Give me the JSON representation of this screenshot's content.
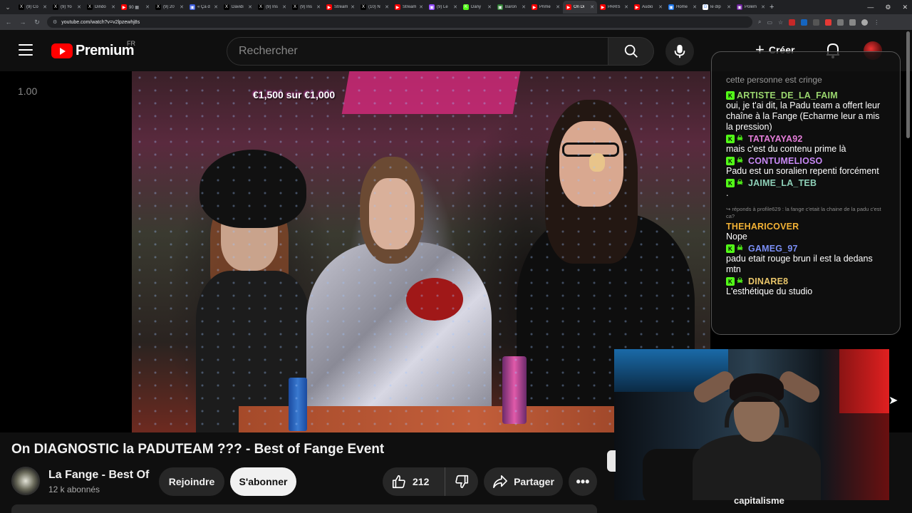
{
  "browser": {
    "tabs": [
      {
        "title": "(9) Co",
        "fav": "X",
        "color": "#000000"
      },
      {
        "title": "(9) Yo",
        "fav": "X",
        "color": "#000000"
      },
      {
        "title": "Dindo",
        "fav": "X",
        "color": "#000000"
      },
      {
        "title": "90 ▦",
        "fav": "▶",
        "color": "#ff0000"
      },
      {
        "title": "(9) 20",
        "fav": "X",
        "color": "#000000"
      },
      {
        "title": "« Ça d",
        "fav": "▣",
        "color": "#3b5bdb"
      },
      {
        "title": "Davidi",
        "fav": "X",
        "color": "#000000"
      },
      {
        "title": "(9) Ins",
        "fav": "X",
        "color": "#000000"
      },
      {
        "title": "(9) Ins",
        "fav": "X",
        "color": "#000000"
      },
      {
        "title": "Stream",
        "fav": "▶",
        "color": "#ff0000"
      },
      {
        "title": "(10) N",
        "fav": "X",
        "color": "#000000"
      },
      {
        "title": "Stream",
        "fav": "▶",
        "color": "#ff0000"
      },
      {
        "title": "(9) Le",
        "fav": "▣",
        "color": "#9146ff"
      },
      {
        "title": "Dany",
        "fav": "K",
        "color": "#53fc18"
      },
      {
        "title": "Baron",
        "fav": "▣",
        "color": "#2e7d32"
      },
      {
        "title": "Prime",
        "fav": "▶",
        "color": "#ff0000"
      },
      {
        "title": "On Di",
        "fav": "▶",
        "color": "#ff0000",
        "active": true
      },
      {
        "title": "PARIS",
        "fav": "▶",
        "color": "#ff0000"
      },
      {
        "title": "Audio",
        "fav": "▶",
        "color": "#ff0000"
      },
      {
        "title": "Home",
        "fav": "▣",
        "color": "#1a73e8"
      },
      {
        "title": "le dîp",
        "fav": "G",
        "color": "#ffffff"
      },
      {
        "title": "Polém",
        "fav": "▣",
        "color": "#6a1b9a"
      }
    ],
    "url": "youtube.com/watch?v=v2lpzewhj8s"
  },
  "header": {
    "logo_text": "Premium",
    "region": "FR",
    "search_placeholder": "Rechercher",
    "create_label": "Créer"
  },
  "player": {
    "speed_label": "1.00",
    "overlay_text": "€1,500 sur €1,000"
  },
  "chat": {
    "top_text": "cette personne est cringe",
    "messages": [
      {
        "user": "ARTISTE_DE_LA_FAIM",
        "color": "#9ad66e",
        "skull": false,
        "text": "oui, je t'ai dit, la Padu team a offert leur chaîne à la Fange (Echarme leur a mis la pression)"
      },
      {
        "user": "TATAYAYA92",
        "color": "#e37dd8",
        "skull": true,
        "text": "mais c'est du contenu prime là"
      },
      {
        "user": "CONTUMELIOSO",
        "color": "#c889f5",
        "skull": true,
        "text": "Padu est un soralien repenti forcément"
      },
      {
        "user": "JAIME_LA_TEB",
        "color": "#8ed0b8",
        "skull": true,
        "text": "."
      },
      {
        "reply": "↪ réponds à profile629 : la fange c'etait la chaine de la padu c'est ca?",
        "user": "THEHARICOVER",
        "color": "#f2b134",
        "skull": false,
        "badge": false,
        "text": "Nope"
      },
      {
        "user": "GAMEG_97",
        "color": "#7a8ef5",
        "skull": true,
        "text": "padu etait rouge brun il est la dedans mtn"
      },
      {
        "user": "DINARE8",
        "color": "#e8c56a",
        "skull": true,
        "text": "L'esthétique du studio"
      }
    ]
  },
  "video": {
    "title": "On DIAGNOSTIC la PADUTEAM ??? - Best of Fange Event",
    "channel_name": "La Fange - Best Of",
    "subscribers": "12 k abonnés",
    "join_label": "Rejoindre",
    "subscribe_label": "S'abonner",
    "likes": "212",
    "share_label": "Partager",
    "comment_hint": "capitalisme"
  }
}
